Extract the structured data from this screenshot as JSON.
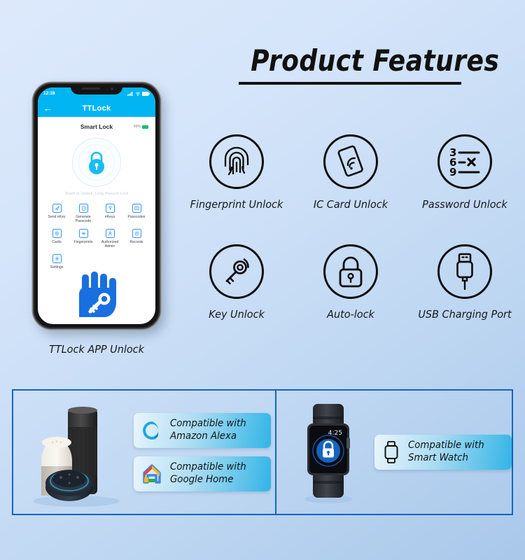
{
  "header": {
    "title": "Product Features"
  },
  "colors": {
    "accent_blue": "#1565c0",
    "app_cyan": "#00b5f2",
    "icon_black": "#0c0c0c",
    "hand_blue": "#1a6fe0",
    "battery_green": "#19bf6d"
  },
  "phone": {
    "status_time": "12:38",
    "app_title": "TTLock",
    "back_icon": "back-arrow-icon",
    "device_name": "Smart Lock",
    "battery_level": "60%",
    "hint": "Touch to Unlock, Long Press to Lock",
    "lock_icon": "padlock-icon",
    "menu": [
      {
        "label": "Send eKey",
        "icon": "send-ekey-icon"
      },
      {
        "label": "Generate Passcode",
        "icon": "generate-passcode-icon"
      },
      {
        "label": "eKeys",
        "icon": "ekeys-icon"
      },
      {
        "label": "Passcodes",
        "icon": "passcodes-icon"
      },
      {
        "label": "Cards",
        "icon": "cards-icon"
      },
      {
        "label": "Fingerprints",
        "icon": "fingerprints-icon"
      },
      {
        "label": "Authorized Admin",
        "icon": "authorized-admin-icon"
      },
      {
        "label": "Records",
        "icon": "records-icon"
      },
      {
        "label": "Settings",
        "icon": "settings-gear-icon"
      }
    ],
    "caption": "TTLock APP Unlock",
    "hand_icon": "hand-with-key-icon"
  },
  "features": [
    {
      "label": "Fingerprint Unlock",
      "icon": "fingerprint-icon"
    },
    {
      "label": "IC Card Unlock",
      "icon": "ic-card-nfc-icon"
    },
    {
      "label": "Password Unlock",
      "icon": "keypad-digits-icon",
      "digits": [
        "3",
        "6",
        "9"
      ]
    },
    {
      "label": "Key Unlock",
      "icon": "key-icon"
    },
    {
      "label": "Auto-lock",
      "icon": "padlock-icon"
    },
    {
      "label": "USB Charging Port",
      "icon": "usb-plug-icon"
    }
  ],
  "compatibility": {
    "badges": [
      {
        "line1": "Compatible with",
        "line2": "Amazon Alexa",
        "icon": "amazon-alexa-logo"
      },
      {
        "line1": "Compatible with",
        "line2": "Google Home",
        "icon": "google-home-logo"
      }
    ],
    "watch": {
      "badge": {
        "line1": "Compatible with",
        "line2": "Smart Watch",
        "icon": "smart-watch-icon"
      },
      "time": "4:25",
      "screen_icon": "padlock-icon"
    },
    "devices_icon": "smart-speakers-group"
  }
}
